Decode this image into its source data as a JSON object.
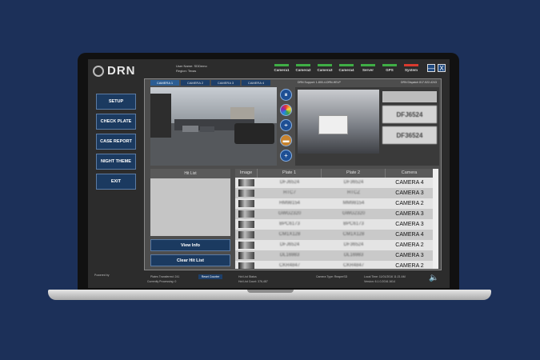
{
  "app": {
    "logo_text": "DRN",
    "user_name": "User Name: SDDemo",
    "region": "Region: Texas"
  },
  "status": [
    {
      "label": "Camera1",
      "state": "ok"
    },
    {
      "label": "Camera2",
      "state": "ok"
    },
    {
      "label": "Camera3",
      "state": "ok"
    },
    {
      "label": "Camera4",
      "state": "ok"
    },
    {
      "label": "Server",
      "state": "ok"
    },
    {
      "label": "GPS",
      "state": "ok"
    },
    {
      "label": "System",
      "state": "error"
    }
  ],
  "window": {
    "minimize": "—",
    "close": "X"
  },
  "colors": {
    "background": "#1c3059",
    "accent": "#1b3a60",
    "ok": "#3fae45",
    "error": "#d83a2e"
  },
  "sidebar": [
    {
      "label": "SETUP"
    },
    {
      "label": "CHECK PLATE"
    },
    {
      "label": "CASE REPORT"
    },
    {
      "label": "NIGHT THEME"
    },
    {
      "label": "EXIT"
    }
  ],
  "tabs": [
    "CAMERA 1",
    "CAMERA 2",
    "CAMERA 3",
    "CAMERA 4"
  ],
  "support": {
    "left": "DRN Support: 1-800-4-DRN-HELP",
    "right": "DRN Dispatch 817-522-4243"
  },
  "plate_view": {
    "read1": "DFJ6524",
    "read2": "DF36524"
  },
  "controls": [
    {
      "icon": "pause-icon",
      "glyph": "⏸"
    },
    {
      "icon": "color-wheel-icon",
      "glyph": ""
    },
    {
      "icon": "compass-icon",
      "glyph": "⌖"
    },
    {
      "icon": "car-icon",
      "glyph": "▬"
    },
    {
      "icon": "add-icon",
      "glyph": "+"
    }
  ],
  "hit_list": {
    "header": "Hit List",
    "view_info": "View Info",
    "clear": "Clear Hit List"
  },
  "table": {
    "headers": [
      "Image",
      "Plate 1",
      "Plate 2",
      "Camera"
    ],
    "rows": [
      {
        "plate1": "DFJ6524",
        "plate2": "DF36524",
        "camera": "CAMERA 4"
      },
      {
        "plate1": "HTC7",
        "plate2": "HTCZ",
        "camera": "CAMERA 3"
      },
      {
        "plate1": "HM98154",
        "plate2": "MM98154",
        "camera": "CAMERA 2"
      },
      {
        "plate1": "GWG2320",
        "plate2": "GWG2320",
        "camera": "CAMERA 3"
      },
      {
        "plate1": "BPC6173",
        "plate2": "BPC6173",
        "camera": "CAMERA 3"
      },
      {
        "plate1": "CM1X128",
        "plate2": "CM1X128",
        "camera": "CAMERA 4"
      },
      {
        "plate1": "DFJ6524",
        "plate2": "DF36524",
        "camera": "CAMERA 2"
      },
      {
        "plate1": "DL16983",
        "plate2": "DL16983",
        "camera": "CAMERA 3"
      },
      {
        "plate1": "CKR4847",
        "plate2": "CKR4847",
        "camera": "CAMERA 2"
      }
    ]
  },
  "footer": {
    "powered_by": "Powered by",
    "plates_transferred": "Plates Transferred: 241",
    "currently_processing": "Currently Processing: 0",
    "reset": "Reset Counter",
    "hot_list_status": "Hot List Status",
    "hot_list_count": "Hot List Count: 376,487",
    "camera_type": "Camera Type: ReaperSD",
    "local_time": "Local Time: 11/01/2016 11:21 AM",
    "version": "Version: 6.1.0.2016.1614"
  }
}
